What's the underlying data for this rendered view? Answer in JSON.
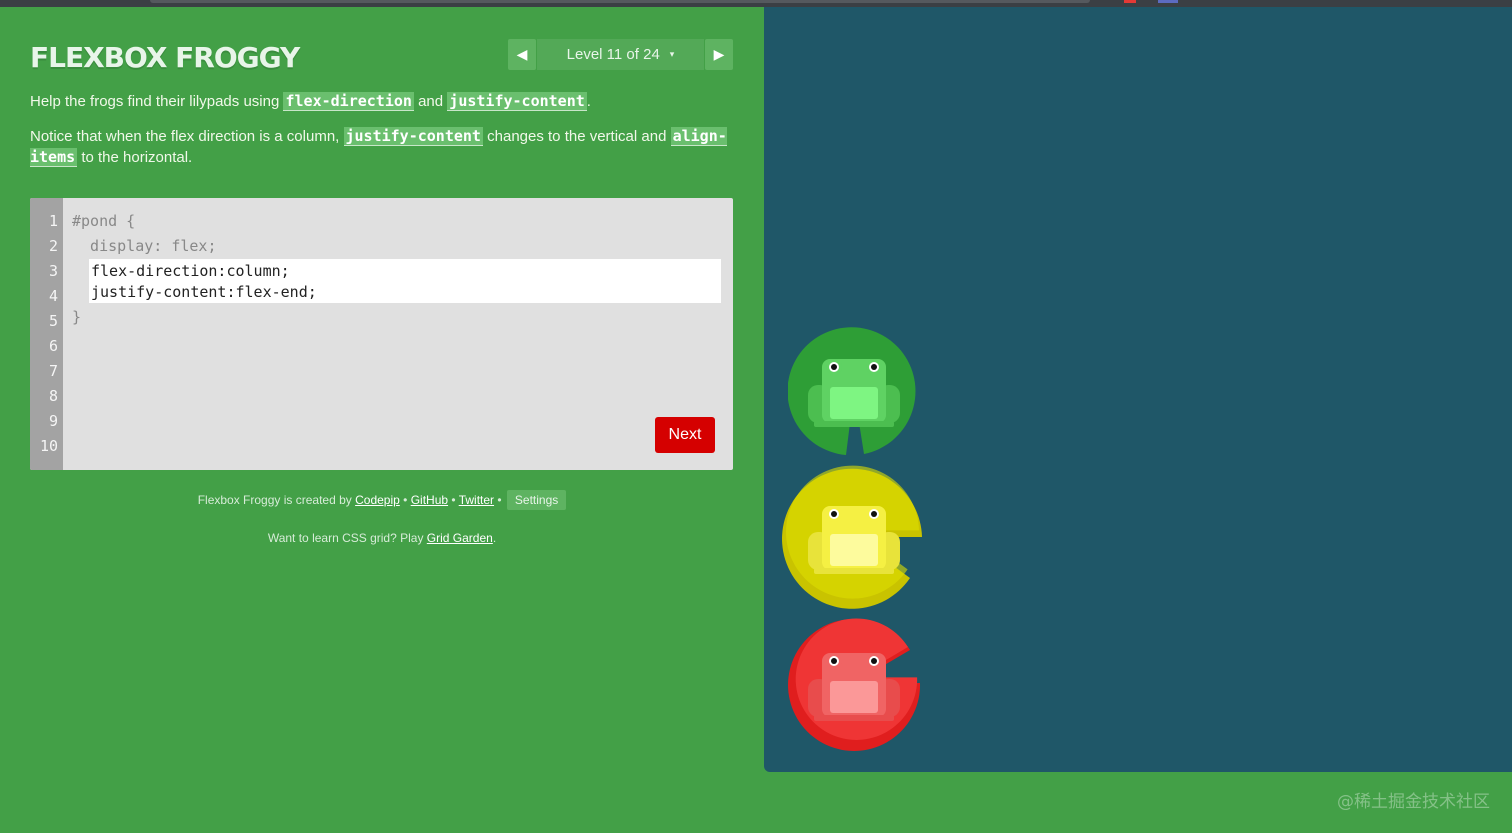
{
  "app": {
    "title": "FLEXBOX FROGGY",
    "level_label": "Level 11 of 24",
    "prev_icon": "◀",
    "next_icon": "▶",
    "caret_icon": "▾"
  },
  "instructions": {
    "p1_text1": "Help the frogs find their lilypads using ",
    "p1_code1": "flex-direction",
    "p1_text2": " and ",
    "p1_code2": "justify-content",
    "p1_text3": ".",
    "p2_text1": "Notice that when the flex direction is a column, ",
    "p2_code1": "justify-content",
    "p2_text2": " changes to the vertical and ",
    "p2_code2": "align-items",
    "p2_text3": " to the horizontal."
  },
  "editor": {
    "line_numbers": [
      "1",
      "2",
      "3",
      "4",
      "5",
      "6",
      "7",
      "8",
      "9",
      "10"
    ],
    "line1": "#pond {",
    "line2": "  display: flex;",
    "answer_line1": "flex-direction:column;",
    "answer_line2": "justify-content:flex-end;",
    "line5": "}",
    "next_label": "Next"
  },
  "credits": {
    "prefix": "Flexbox Froggy is created by ",
    "codepip": "Codepip",
    "sep": " • ",
    "github": "GitHub",
    "twitter": "Twitter",
    "settings": "Settings",
    "grid_prefix": "Want to learn CSS grid? Play ",
    "grid_link": "Grid Garden",
    "grid_suffix": "."
  },
  "pond": {
    "frogs": [
      {
        "color": "green",
        "pad_hex": "#2e9e36",
        "body_hex": "#5fd263",
        "belly_hex": "#7ef582"
      },
      {
        "color": "yellow",
        "pad_hex": "#c9c300",
        "body_hex": "#f5f043",
        "belly_hex": "#fdfb9d"
      },
      {
        "color": "red",
        "pad_hex": "#e01e1e",
        "body_hex": "#f06464",
        "belly_hex": "#fb9898"
      }
    ],
    "background_hex": "#1f5768"
  },
  "watermark": "@稀土掘金技术社区"
}
